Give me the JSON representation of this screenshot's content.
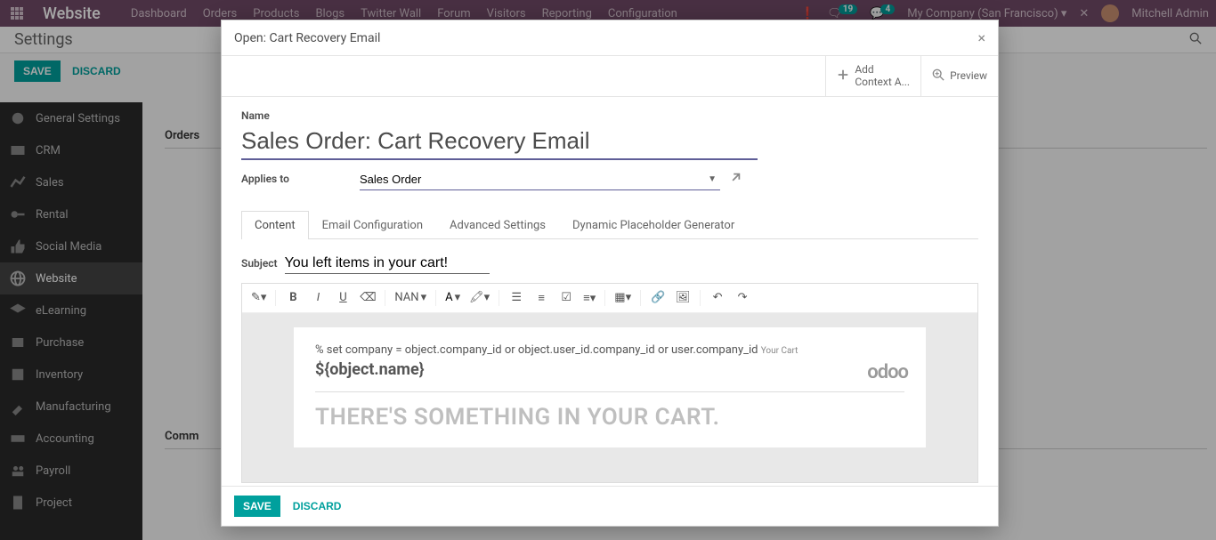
{
  "topbar": {
    "brand": "Website",
    "nav": [
      "Dashboard",
      "Orders",
      "Products",
      "Blogs",
      "Twitter Wall",
      "Forum",
      "Visitors",
      "Reporting",
      "Configuration"
    ],
    "chat_badge": "19",
    "msg_badge": "4",
    "company": "My Company (San Francisco)",
    "user": "Mitchell Admin"
  },
  "header2": {
    "title": "Settings"
  },
  "actionbar": {
    "save": "SAVE",
    "discard": "DISCARD"
  },
  "sidebar": {
    "items": [
      {
        "label": "General Settings"
      },
      {
        "label": "CRM"
      },
      {
        "label": "Sales"
      },
      {
        "label": "Rental"
      },
      {
        "label": "Social Media"
      },
      {
        "label": "Website"
      },
      {
        "label": "eLearning"
      },
      {
        "label": "Purchase"
      },
      {
        "label": "Inventory"
      },
      {
        "label": "Manufacturing"
      },
      {
        "label": "Accounting"
      },
      {
        "label": "Payroll"
      },
      {
        "label": "Project"
      }
    ],
    "active_index": 5
  },
  "content": {
    "section_orders": "Orders",
    "section_comm": "Comm"
  },
  "modal": {
    "title": "Open: Cart Recovery Email",
    "actions": {
      "add_ctx_l1": "Add",
      "add_ctx_l2": "Context A...",
      "preview": "Preview"
    },
    "form": {
      "name_label": "Name",
      "name_value": "Sales Order: Cart Recovery Email",
      "applies_label": "Applies to",
      "applies_value": "Sales Order"
    },
    "tabs": [
      "Content",
      "Email Configuration",
      "Advanced Settings",
      "Dynamic Placeholder Generator"
    ],
    "subject_label": "Subject",
    "subject_value": "You left items in your cart!",
    "rte_font": "NAN",
    "email": {
      "line1a": "% set company = object.company_id or object.user_id.company_id or user.company_id",
      "line1b": "Your Cart",
      "objname": "${object.name}",
      "big": "THERE'S SOMETHING IN YOUR CART.",
      "logo": "odoo"
    },
    "footer": {
      "save": "SAVE",
      "discard": "DISCARD"
    }
  }
}
